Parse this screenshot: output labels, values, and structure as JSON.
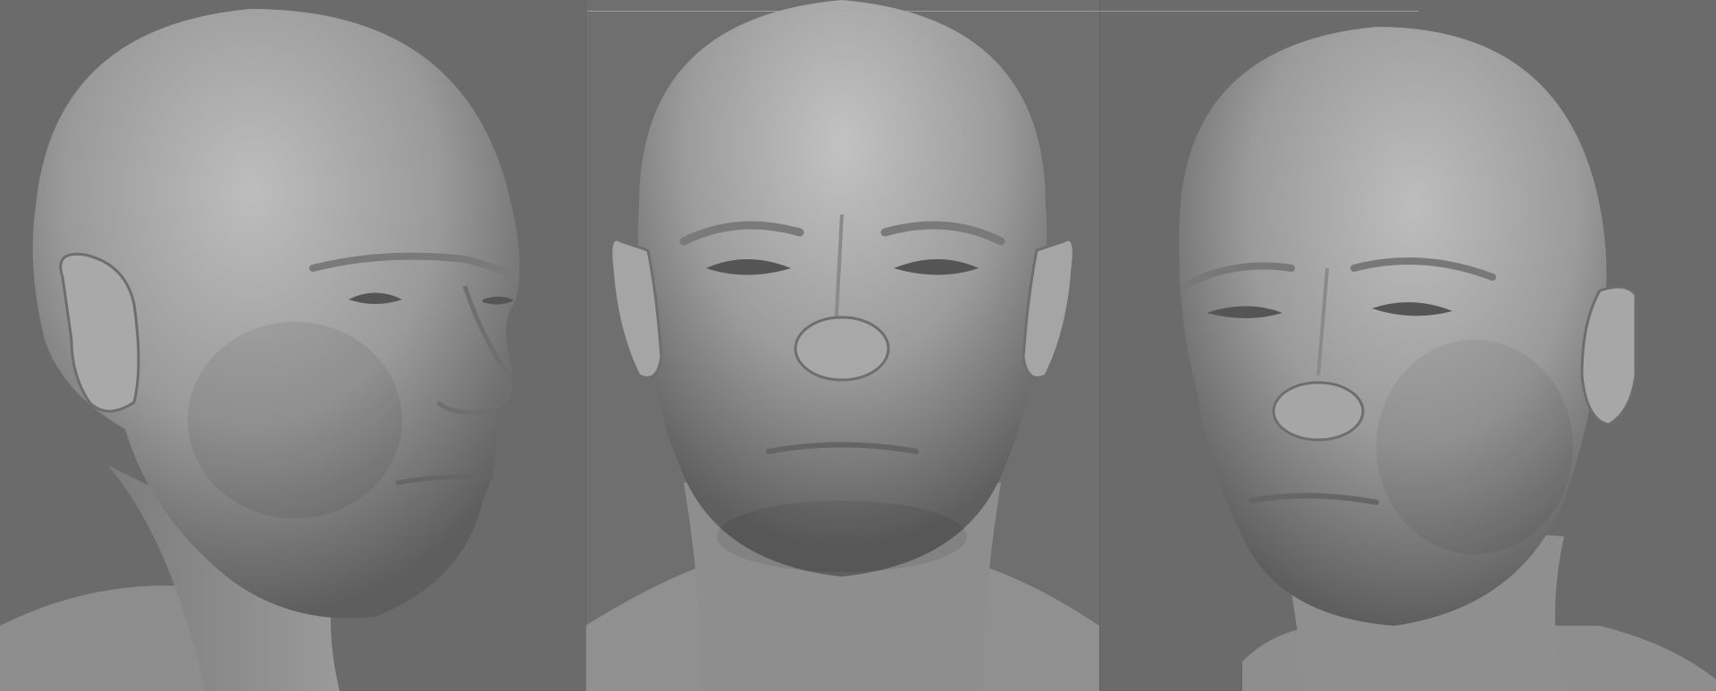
{
  "scene": {
    "background_color": "#6b6b6b",
    "material_color": "#a3a3a3",
    "views": [
      {
        "id": "left",
        "view": "three-quarter-right"
      },
      {
        "id": "center",
        "view": "front"
      },
      {
        "id": "right",
        "view": "three-quarter-left"
      }
    ]
  }
}
